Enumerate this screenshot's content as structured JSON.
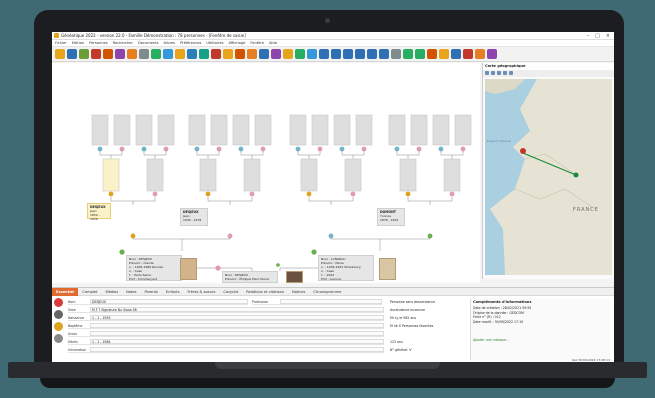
{
  "window": {
    "title": "Généatique 2022 - version 22.0 - Famille Démonstration : 78 personnes - [Fenêtre de saisie]"
  },
  "menu": [
    "Fichier",
    "Edition",
    "Personnes",
    "Rechercher",
    "Documents",
    "Arbres",
    "Préférences",
    "Utilitaires",
    "Affichage",
    "Fenêtre",
    "Aide"
  ],
  "map": {
    "title": "Carte géographique",
    "labels": [
      "FRANCE",
      "English Channel"
    ]
  },
  "tree": {
    "person_main": {
      "name": "DESJEUX",
      "first": "Jean",
      "dates": "1945 - 1978"
    },
    "person_left": {
      "name": "DESJEUX",
      "first": "Jean",
      "dates": "1850 - 1929"
    },
    "person_right": {
      "name": "DUMONT",
      "first": "Yvonne",
      "dates": "1876 - 1955"
    },
    "focus": {
      "lines": [
        "Nom : DESJEUX",
        "Prénom : Philippe Marc Pierre",
        "n. : 1945-1978 Rennes",
        "o. : Médecin",
        "p. : Poitie",
        "Prof : Ingénieur"
      ]
    },
    "father": {
      "lines": [
        "Nom : DESJEUX",
        "Prénom : Claude",
        "n. : 1905-1986 Rennes",
        "o. : Caen",
        "†. : Paris-Seine",
        "Prof : Commerçant"
      ]
    },
    "mother": {
      "lines": [
        "Nom : LANGEAU",
        "Prénom : Marie",
        "n. : 1909-1993 Strasbourg",
        "o. : Caen",
        "†. : 1994",
        "Prof : Aucuna"
      ]
    }
  },
  "bottom": {
    "tabs": [
      "Essentiel",
      "Complet",
      "Médias",
      "Notes",
      "Parents",
      "Enfants",
      "Frères & soeurs",
      "Conjoint",
      "Relations et citations",
      "Notices",
      "Chronogramme"
    ],
    "rows": [
      {
        "label": "Nom",
        "value": "DESJEUX"
      },
      {
        "label": "Sexe",
        "value": "M  F  ?  Signature   Nu Siosa  58"
      },
      {
        "label": "Naissance",
        "value": "1 - 1 - 1955"
      },
      {
        "label": "Baptême",
        "value": ""
      },
      {
        "label": "Union",
        "value": ""
      },
      {
        "label": "Décès",
        "value": "1 - 1 - 1984"
      },
      {
        "label": "Inhumation",
        "value": ""
      }
    ],
    "profession_label": "Profession",
    "right_col": [
      "Personne sans descendance",
      "Ascendance inconnue",
      "Mr Ly le 562 ans",
      "M né X  Personnes favorites",
      "",
      "123 ans",
      "N° général: V"
    ],
    "complement": {
      "title": "Compléments d'informations",
      "lines": [
        "Date de création : 28/02/2021 09:55",
        "Origine de la donnée : GEDCOM",
        "Fiche n° (R) : 012",
        "Date modif. : 30/09/2022 17:10"
      ],
      "add_label": "Ajouter une rubrique..."
    },
    "status": "Gsk 30/09/2022 17:08:14"
  }
}
